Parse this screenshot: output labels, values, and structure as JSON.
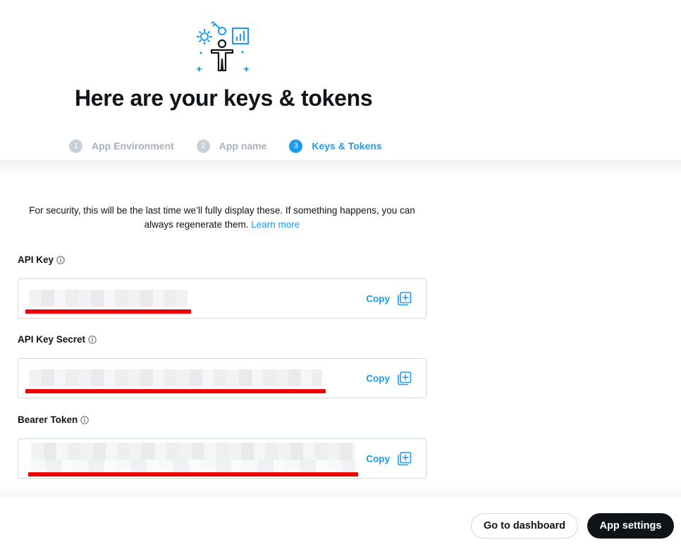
{
  "header": {
    "title": "Here are your keys & tokens",
    "illustration_icon": "developer-keys-illustration"
  },
  "stepper": {
    "steps": [
      {
        "number": "1",
        "label": "App Environment",
        "state": "completed"
      },
      {
        "number": "2",
        "label": "App name",
        "state": "completed"
      },
      {
        "number": "3",
        "label": "Keys & Tokens",
        "state": "active"
      }
    ]
  },
  "notice": {
    "text": "For security, this will be the last time we’ll fully display these. If something happens, you can always regenerate them.",
    "link_label": "Learn more"
  },
  "fields": [
    {
      "label": "API Key",
      "info_icon": "info-icon",
      "value": "",
      "copy_label": "Copy",
      "copy_icon": "copy-icon"
    },
    {
      "label": "API Key Secret",
      "info_icon": "info-icon",
      "value": "",
      "copy_label": "Copy",
      "copy_icon": "copy-icon"
    },
    {
      "label": "Bearer Token",
      "info_icon": "info-icon",
      "value": "",
      "copy_label": "Copy",
      "copy_icon": "copy-icon"
    }
  ],
  "footer": {
    "dashboard_label": "Go to dashboard",
    "settings_label": "App settings"
  },
  "colors": {
    "accent": "#1d9bf0",
    "text": "#0f1419",
    "muted": "#a7b1bb",
    "redaction": "#ee0000",
    "primary_button": "#0f1419"
  }
}
